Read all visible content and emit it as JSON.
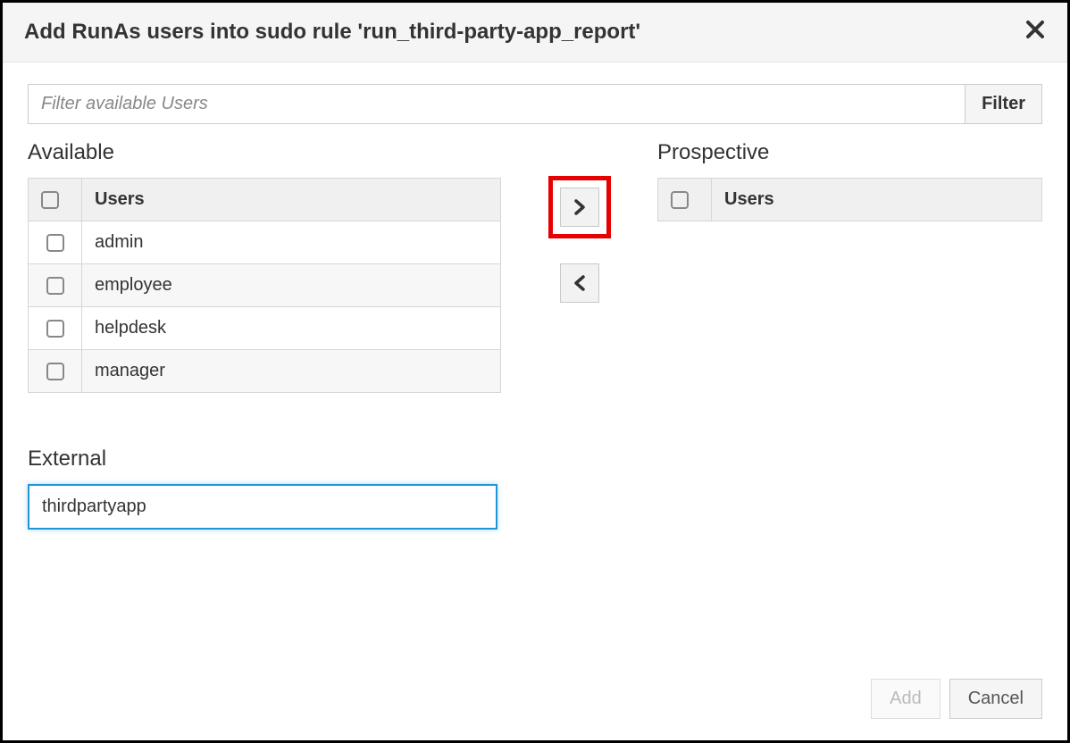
{
  "dialog": {
    "title": "Add RunAs users into sudo rule 'run_third-party-app_report'"
  },
  "filter": {
    "placeholder": "Filter available Users",
    "button_label": "Filter"
  },
  "available": {
    "title": "Available",
    "column_header": "Users",
    "rows": [
      "admin",
      "employee",
      "helpdesk",
      "manager"
    ]
  },
  "prospective": {
    "title": "Prospective",
    "column_header": "Users",
    "rows": []
  },
  "external": {
    "title": "External",
    "value": "thirdpartyapp"
  },
  "footer": {
    "add_label": "Add",
    "cancel_label": "Cancel"
  }
}
